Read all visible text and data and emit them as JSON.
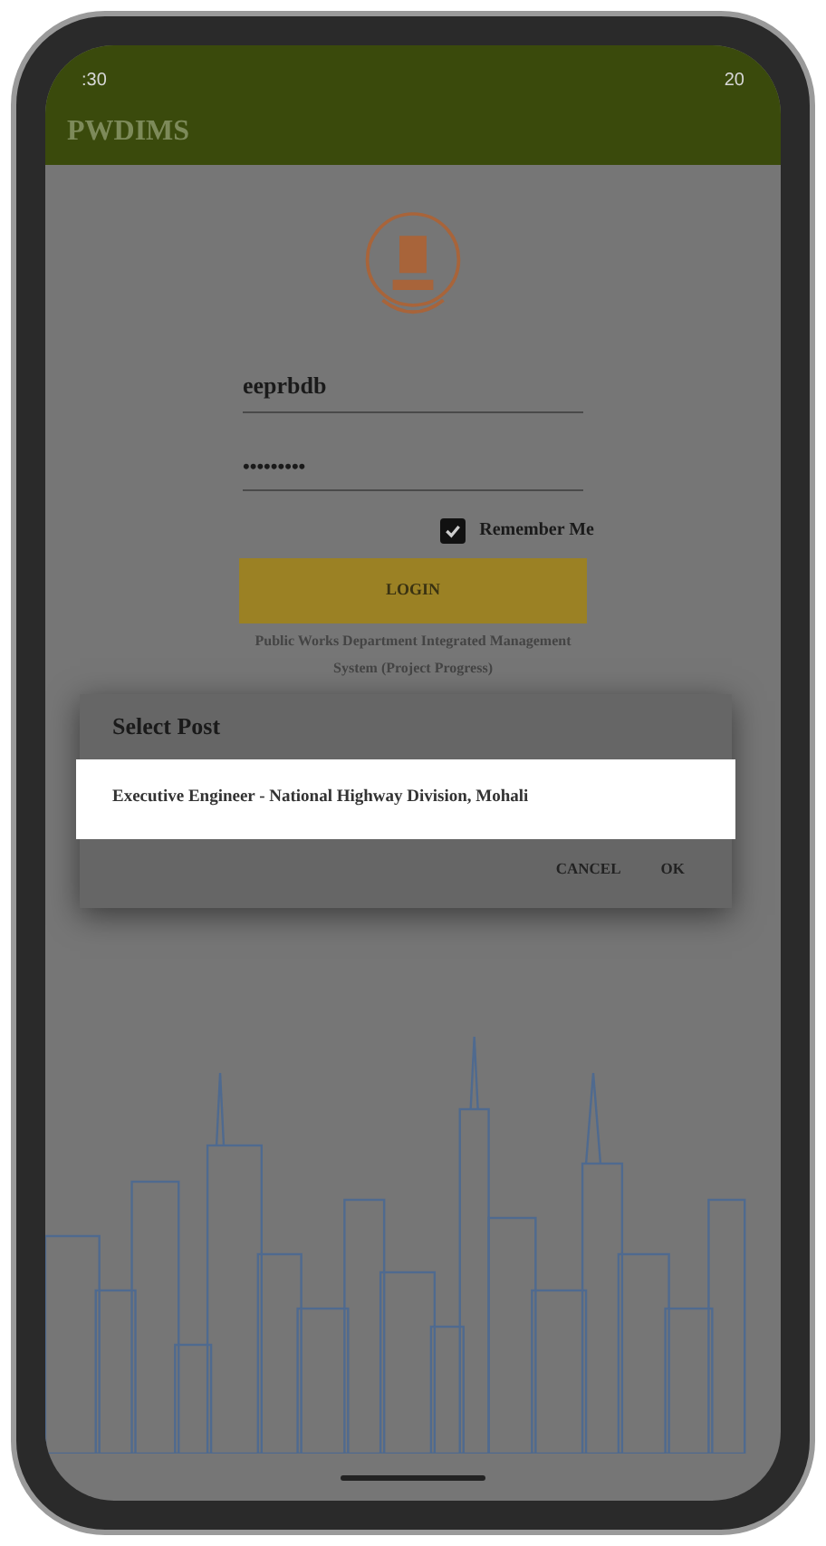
{
  "status_bar": {
    "time": ":30",
    "battery": "20"
  },
  "app_bar": {
    "title": "PWDIMS"
  },
  "login": {
    "username": {
      "value": "eeprbdb"
    },
    "password": {
      "value": "•••••••••"
    },
    "remember_me": {
      "label": "Remember Me",
      "checked": true
    },
    "button": "LOGIN",
    "caption": "Public Works Department Integrated Management System  (Project Progress)"
  },
  "dialog": {
    "title": "Select Post",
    "items": [
      {
        "label": "Executive Engineer - National Highway Division, Mohali",
        "selected": true
      }
    ],
    "buttons": [
      "CANCEL",
      "OK"
    ]
  }
}
